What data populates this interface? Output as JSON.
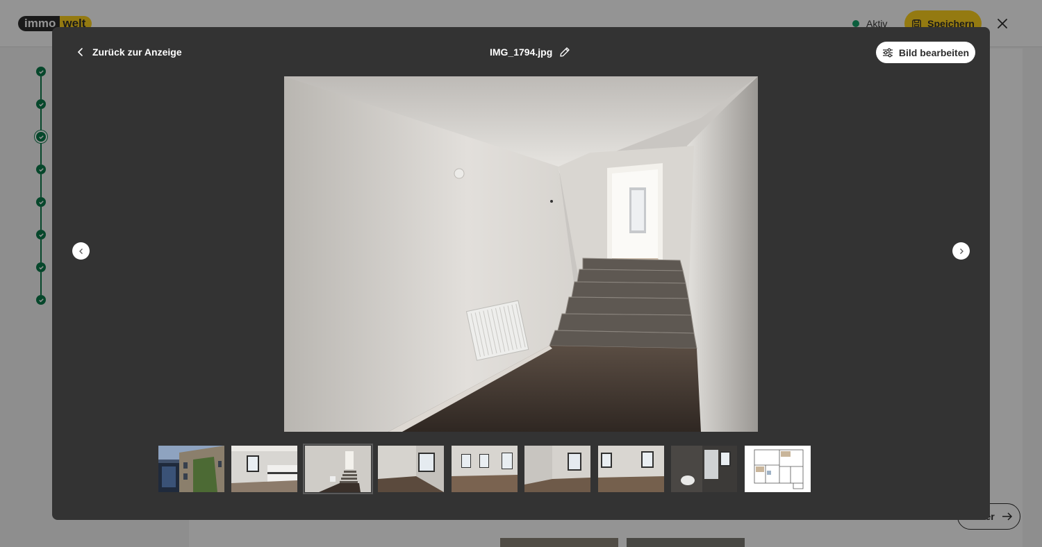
{
  "background": {
    "logo": {
      "part1": "immo",
      "part2": "welt"
    },
    "status": {
      "label": "Aktiv",
      "color": "#13a36a"
    },
    "save_label": "Speichern",
    "next_label": "Weiter",
    "brand_color": "#ffd21e",
    "step_color": "#0b7a4b",
    "steps": [
      {
        "state": "done"
      },
      {
        "state": "done"
      },
      {
        "state": "current"
      },
      {
        "state": "done"
      },
      {
        "state": "done"
      },
      {
        "state": "done"
      },
      {
        "state": "done"
      },
      {
        "state": "done"
      }
    ]
  },
  "viewer": {
    "back_label": "Zurück zur Anzeige",
    "file_name": "IMG_1794.jpg",
    "edit_label": "Bild bearbeiten",
    "prev_icon": "chevron-left-icon",
    "next_icon": "chevron-right-icon",
    "active_index": 2,
    "thumbnails": [
      {
        "id": "exterior"
      },
      {
        "id": "kitchen"
      },
      {
        "id": "hallway-stairs"
      },
      {
        "id": "room-window-1"
      },
      {
        "id": "room-windows-2"
      },
      {
        "id": "room-window-3"
      },
      {
        "id": "room-windows-4"
      },
      {
        "id": "bathroom"
      },
      {
        "id": "floor-plan"
      }
    ]
  }
}
